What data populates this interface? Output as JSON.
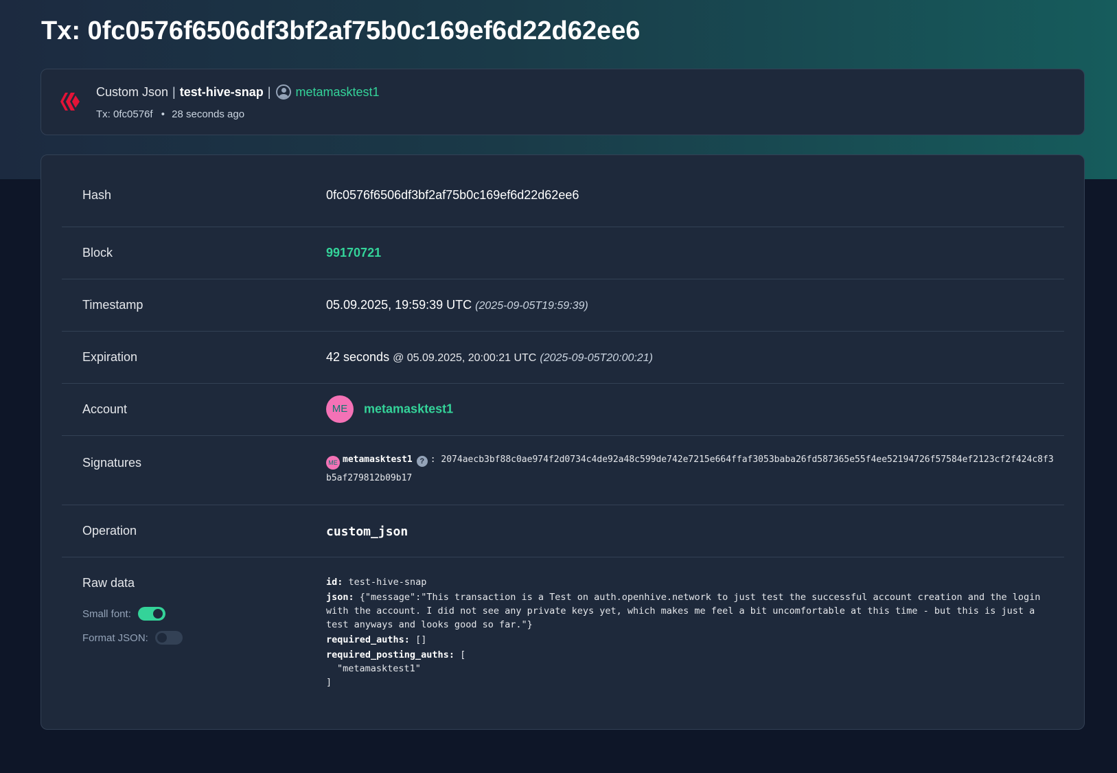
{
  "header": {
    "title": "Tx: 0fc0576f6506df3bf2af75b0c169ef6d22d62ee6"
  },
  "summary": {
    "operation": "Custom Json",
    "separator": "|",
    "app_id": "test-hive-snap",
    "account": "metamasktest1",
    "tx_short": "Tx: 0fc0576f",
    "dot": "•",
    "age": "28 seconds ago",
    "brand_color": "#e31337"
  },
  "details": {
    "hash": {
      "label": "Hash",
      "value": "0fc0576f6506df3bf2af75b0c169ef6d22d62ee6"
    },
    "block": {
      "label": "Block",
      "value": "99170721"
    },
    "timestamp": {
      "label": "Timestamp",
      "value": "05.09.2025, 19:59:39 UTC",
      "iso": "(2025-09-05T19:59:39)"
    },
    "expiration": {
      "label": "Expiration",
      "relative": "42 seconds",
      "at": "@ 05.09.2025, 20:00:21 UTC",
      "iso": "(2025-09-05T20:00:21)"
    },
    "account": {
      "label": "Account",
      "avatar_initials": "ME",
      "name": "metamasktest1"
    },
    "signatures": {
      "label": "Signatures",
      "avatar_initials": "ME",
      "signer": "metamasktest1",
      "help": "?",
      "colon": ":",
      "value": "2074aecb3bf88c0ae974f2d0734c4de92a48c599de742e7215e664ffaf3053baba26fd587365e55f4ee52194726f57584ef2123cf2f424c8f3b5af279812b09b17"
    },
    "operation": {
      "label": "Operation",
      "value": "custom_json"
    },
    "raw_data": {
      "label": "Raw data",
      "small_font_label": "Small font:",
      "small_font_on": true,
      "format_json_label": "Format JSON:",
      "format_json_on": false,
      "id_key": "id",
      "id_value": "test-hive-snap",
      "json_key": "json",
      "json_value": "{\"message\":\"This transaction is a Test on auth.openhive.network to just test the successful account creation and the login with the account. I did not see any private keys yet, which makes me feel a bit uncomfortable at this time - but this is just a test anyways and looks good so far.\"}",
      "required_auths_key": "required_auths",
      "required_auths_value": "[]",
      "required_posting_auths_key": "required_posting_auths",
      "required_posting_auths_open": "[",
      "required_posting_auths_item": "\"metamasktest1\"",
      "required_posting_auths_close": "]"
    }
  },
  "colors": {
    "accent_green": "#34d399",
    "avatar_pink": "#f472b6",
    "card_bg": "#1e293b",
    "page_bg": "#0e1628"
  }
}
